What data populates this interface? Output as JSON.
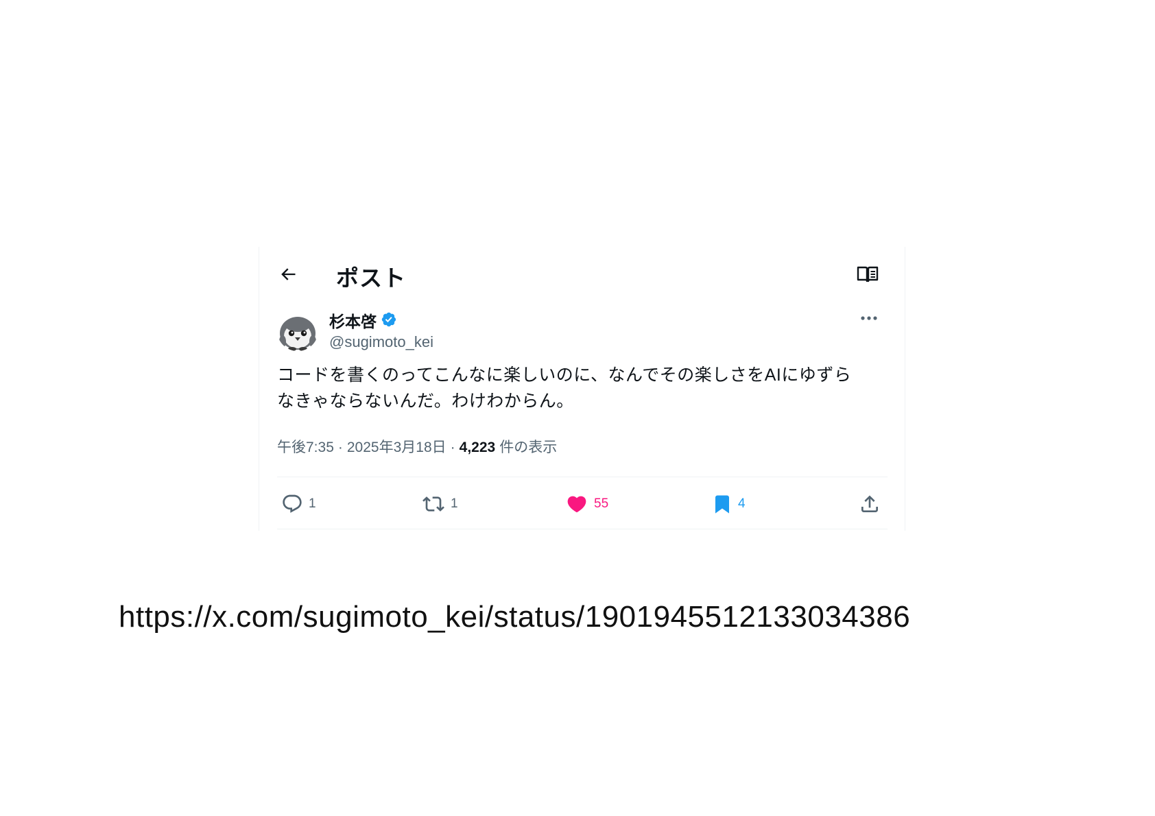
{
  "header": {
    "title": "ポスト",
    "back_icon": "arrow-left-icon",
    "reader_icon": "open-book-icon"
  },
  "author": {
    "display_name": "杉本啓",
    "handle": "@sugimoto_kei",
    "verified": true,
    "verified_color": "#1d9bf0",
    "avatar_icon": "penguin-avatar"
  },
  "tweet": {
    "text": "コードを書くのってこんなに楽しいのに、なんでその楽しさをAIにゆずら\nなきゃならないんだ。わけわからん。"
  },
  "meta": {
    "time": "午後7:35",
    "separator": "·",
    "date": "2025年3月18日",
    "views_count": "4,223",
    "views_label": "件の表示"
  },
  "actions": {
    "reply_count": "1",
    "repost_count": "1",
    "like_count": "55",
    "bookmark_count": "4",
    "like_color": "#f91880",
    "bookmark_color": "#1d9bf0"
  },
  "source_url": "https://x.com/sugimoto_kei/status/1901945512133034386"
}
